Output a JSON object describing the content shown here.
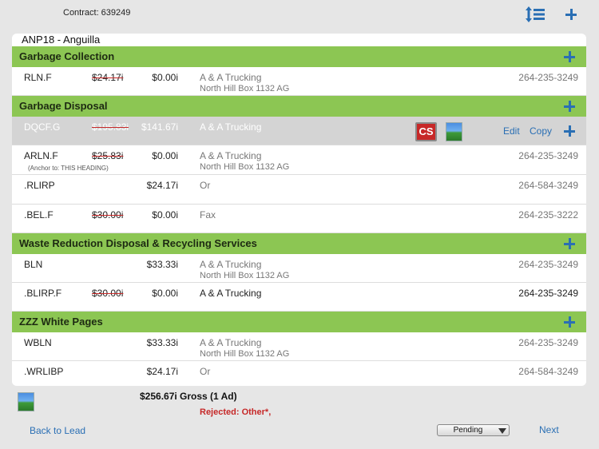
{
  "header": {
    "contract_label": "Contract: 639249",
    "sort_icon": "sort-icon",
    "add_icon": "plus-icon"
  },
  "card": {
    "title": "ANP18 - Anguilla"
  },
  "sections": [
    {
      "label": "Garbage Collection",
      "rows": [
        {
          "code": "RLN.F",
          "orig": "$24.17i",
          "price": "$0.00i",
          "vendor": "A & A Trucking",
          "address": "North Hill Box 1132 AG",
          "phone": "264-235-3249"
        }
      ]
    },
    {
      "label": "Garbage Disposal",
      "rows": [
        {
          "code": "DQCF.G",
          "orig": "$195.83i",
          "price": "$141.67i",
          "vendor": "A & A Trucking",
          "actions": {
            "edit": "Edit",
            "copy": "Copy"
          }
        },
        {
          "code": "ARLN.F",
          "anchor": "(Anchor to: THIS HEADING)",
          "orig": "$25.83i",
          "price": "$0.00i",
          "vendor": "A & A Trucking",
          "address": "North Hill Box 1132 AG",
          "phone": "264-235-3249"
        },
        {
          "code": ".RLIRP",
          "price": "$24.17i",
          "vendor": "Or",
          "phone": "264-584-3249"
        },
        {
          "code": ".BEL.F",
          "orig": "$30.00i",
          "price": "$0.00i",
          "vendor": "Fax",
          "phone": "264-235-3222"
        }
      ]
    },
    {
      "label": "Waste Reduction Disposal & Recycling Services",
      "rows": [
        {
          "code": "BLN",
          "price": "$33.33i",
          "vendor": "A & A Trucking",
          "address": "North Hill Box 1132 AG",
          "phone": "264-235-3249"
        },
        {
          "code": ".BLIRP.F",
          "orig": "$30.00i",
          "price": "$0.00i",
          "vendor": "A & A Trucking",
          "phone": "264-235-3249"
        }
      ]
    },
    {
      "label": "ZZZ White Pages",
      "rows": [
        {
          "code": "WBLN",
          "price": "$33.33i",
          "vendor": "A & A Trucking",
          "address": "North Hill Box 1132 AG",
          "phone": "264-235-3249"
        },
        {
          "code": ".WRLIBP",
          "price": "$24.17i",
          "vendor": "Or",
          "phone": "264-584-3249"
        }
      ]
    }
  ],
  "footer": {
    "total": "$256.67i  Gross  (1 Ad)",
    "rejected": "Rejected: Other*,",
    "back_label": "Back to Lead",
    "status_value": "Pending",
    "next_label": "Next"
  },
  "colors": {
    "section_bg": "#8cc653",
    "accent": "#2a6fb4",
    "rejected": "#c62828"
  }
}
